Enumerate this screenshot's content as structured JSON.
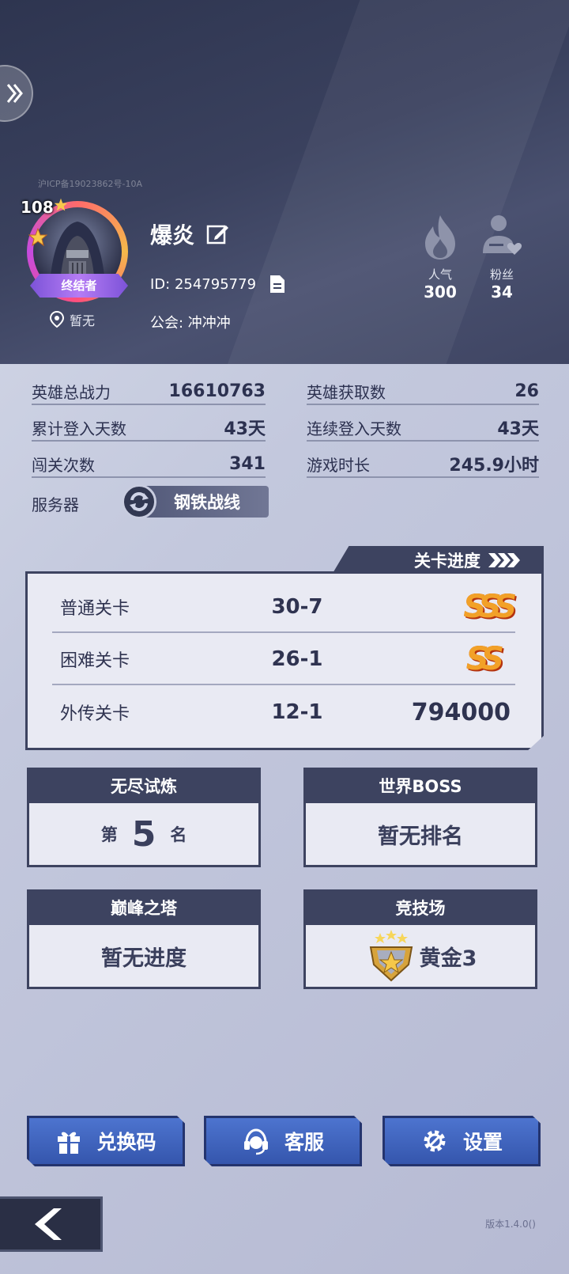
{
  "header": {
    "icp": "沪ICP备19023862号-10A",
    "avatar": {
      "level": "108",
      "title": "终结者"
    },
    "location": "暂无",
    "name": "爆炎",
    "id_text": "ID: 254795779",
    "guild_text": "公会: 冲冲冲",
    "popularity": {
      "label": "人气",
      "value": "300"
    },
    "fans": {
      "label": "粉丝",
      "value": "34"
    }
  },
  "info": {
    "power_label": "英雄总战力",
    "power_value": "16610763",
    "heroes_label": "英雄获取数",
    "heroes_value": "26",
    "login_label": "累计登入天数",
    "login_value": "43天",
    "streak_label": "连续登入天数",
    "streak_value": "43天",
    "clears_label": "闯关次数",
    "clears_value": "341",
    "playtime_label": "游戏时长",
    "playtime_value": "245.9小时",
    "server_label": "服务器",
    "server_value": "钢铁战线"
  },
  "progress": {
    "tab_label": "关卡进度",
    "rows": [
      {
        "name": "普通关卡",
        "stage": "30-7",
        "rank": "SSS"
      },
      {
        "name": "困难关卡",
        "stage": "26-1",
        "rank": "SS"
      },
      {
        "name": "外传关卡",
        "stage": "12-1",
        "rank": "794000"
      }
    ]
  },
  "cards": {
    "endless": {
      "title": "无尽试炼",
      "prefix": "第",
      "rank": "5",
      "suffix": "名"
    },
    "boss": {
      "title": "世界BOSS",
      "value": "暂无排名"
    },
    "tower": {
      "title": "巅峰之塔",
      "value": "暂无进度"
    },
    "arena": {
      "title": "竞技场",
      "value": "黄金3"
    }
  },
  "buttons": {
    "redeem": "兑换码",
    "service": "客服",
    "settings": "设置"
  },
  "version": "版本1.4.0()",
  "colors": {
    "panel_dark": "#3d4360",
    "button_blue": "#4060bd",
    "rank_gold": "#f2a128"
  }
}
